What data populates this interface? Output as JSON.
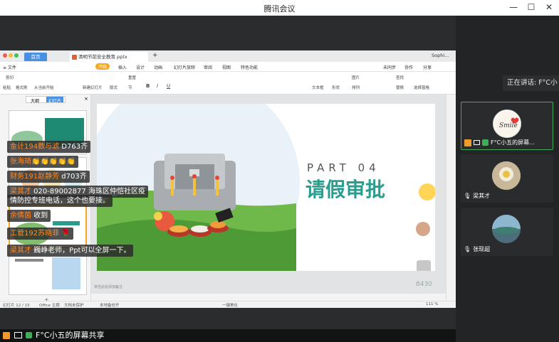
{
  "window": {
    "title": "腾讯会议",
    "min": "—",
    "max": "☐",
    "close": "✕"
  },
  "speaking": "正在讲话: F°C小",
  "participants": [
    {
      "name": "F°C小五的屏幕...",
      "avatar_text": "Smile"
    },
    {
      "name": "梁其才"
    },
    {
      "name": "张现超"
    }
  ],
  "browser": {
    "home_tab": "首页",
    "doc_tab": "清明节前安全教育.pptx",
    "add_tab": "+",
    "user": "Sophi..."
  },
  "menu": {
    "file": "≡ 文件",
    "items": [
      "开始",
      "插入",
      "设计",
      "动画",
      "幻灯片放映",
      "审阅",
      "视图",
      "特色功能"
    ],
    "sync": "未同步",
    "collab": "协作",
    "share": "分享"
  },
  "ribbon": {
    "cut": "剪切",
    "paste": "粘贴",
    "format_painter": "格式刷",
    "from_start": "从当前开始",
    "new_slide": "新建幻灯片",
    "layout": "版式",
    "section": "节",
    "reset": "重置",
    "textbox": "文本框",
    "shape": "形状",
    "arrange": "排列",
    "picture": "图片",
    "find": "查找",
    "replace": "替换",
    "select_pane": "选择窗格",
    "outline_tab": "大纲",
    "slides_tab": "幻灯片"
  },
  "slide": {
    "part": "PART 04",
    "heading": "请假审批"
  },
  "status": {
    "slide_no": "幻灯片 12 / 15",
    "theme": "Office 主题",
    "protect": "文档未保护",
    "backup": "本地备份开",
    "beautify": "一键美化",
    "zoom": "111 %",
    "notes": "单击此处添加备注"
  },
  "likes": "8430",
  "danmu": [
    {
      "user": "金计194数与滤",
      "text": " D763齐"
    },
    {
      "user": "张海琦",
      "text": "👏👏👏👏👏"
    },
    {
      "user": "财务191赵静芳",
      "text": " d703齐"
    },
    {
      "user": "梁其才",
      "text": " 020-89002877 海珠区仲恺社区疫"
    },
    {
      "user": "",
      "text": "情防控专班电话，这个也要接。"
    },
    {
      "user": "余倩茵",
      "text": " 收到"
    },
    {
      "user": "工管192苏晓菲",
      "text": " 🌹"
    },
    {
      "user": "梁其才",
      "text": " 巍峥老师，Ppt可以全屏一下。"
    }
  ],
  "bottom": {
    "share_text": "F°C小五的屏幕共享"
  },
  "colors": {
    "accent_green": "#3fae5a",
    "slide_teal": "#2a9d8f",
    "home_tab_blue": "#4a90e2"
  }
}
